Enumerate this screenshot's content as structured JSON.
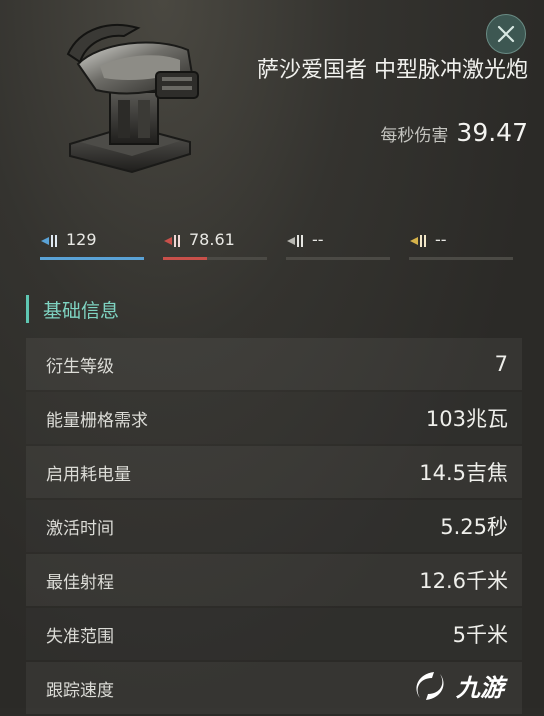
{
  "item": {
    "name": "萨沙爱国者 中型脉冲激光炮",
    "dps_label": "每秒伤害",
    "dps_value": "39.47"
  },
  "damage_stats": [
    {
      "icon": "em-damage-icon",
      "value": "129",
      "fill": 1.0,
      "color": "#5aa2d6"
    },
    {
      "icon": "thermal-damage-icon",
      "value": "78.61",
      "fill": 0.42,
      "color": "#c8504a"
    },
    {
      "icon": "kinetic-damage-icon",
      "value": "--",
      "fill": 0,
      "color": "#b8b8b2"
    },
    {
      "icon": "explosive-damage-icon",
      "value": "--",
      "fill": 0,
      "color": "#d6b24a"
    }
  ],
  "section": {
    "title": "基础信息"
  },
  "attributes": [
    {
      "label": "衍生等级",
      "value": "7"
    },
    {
      "label": "能量栅格需求",
      "value": "103兆瓦"
    },
    {
      "label": "启用耗电量",
      "value": "14.5吉焦"
    },
    {
      "label": "激活时间",
      "value": "5.25秒"
    },
    {
      "label": "最佳射程",
      "value": "12.6千米"
    },
    {
      "label": "失准范围",
      "value": "5千米"
    },
    {
      "label": "跟踪速度",
      "value": ""
    }
  ],
  "watermark": {
    "text": "九游"
  },
  "colors": {
    "accent": "#5fc7b3",
    "em": "#5aa2d6",
    "thermal": "#c8504a"
  }
}
